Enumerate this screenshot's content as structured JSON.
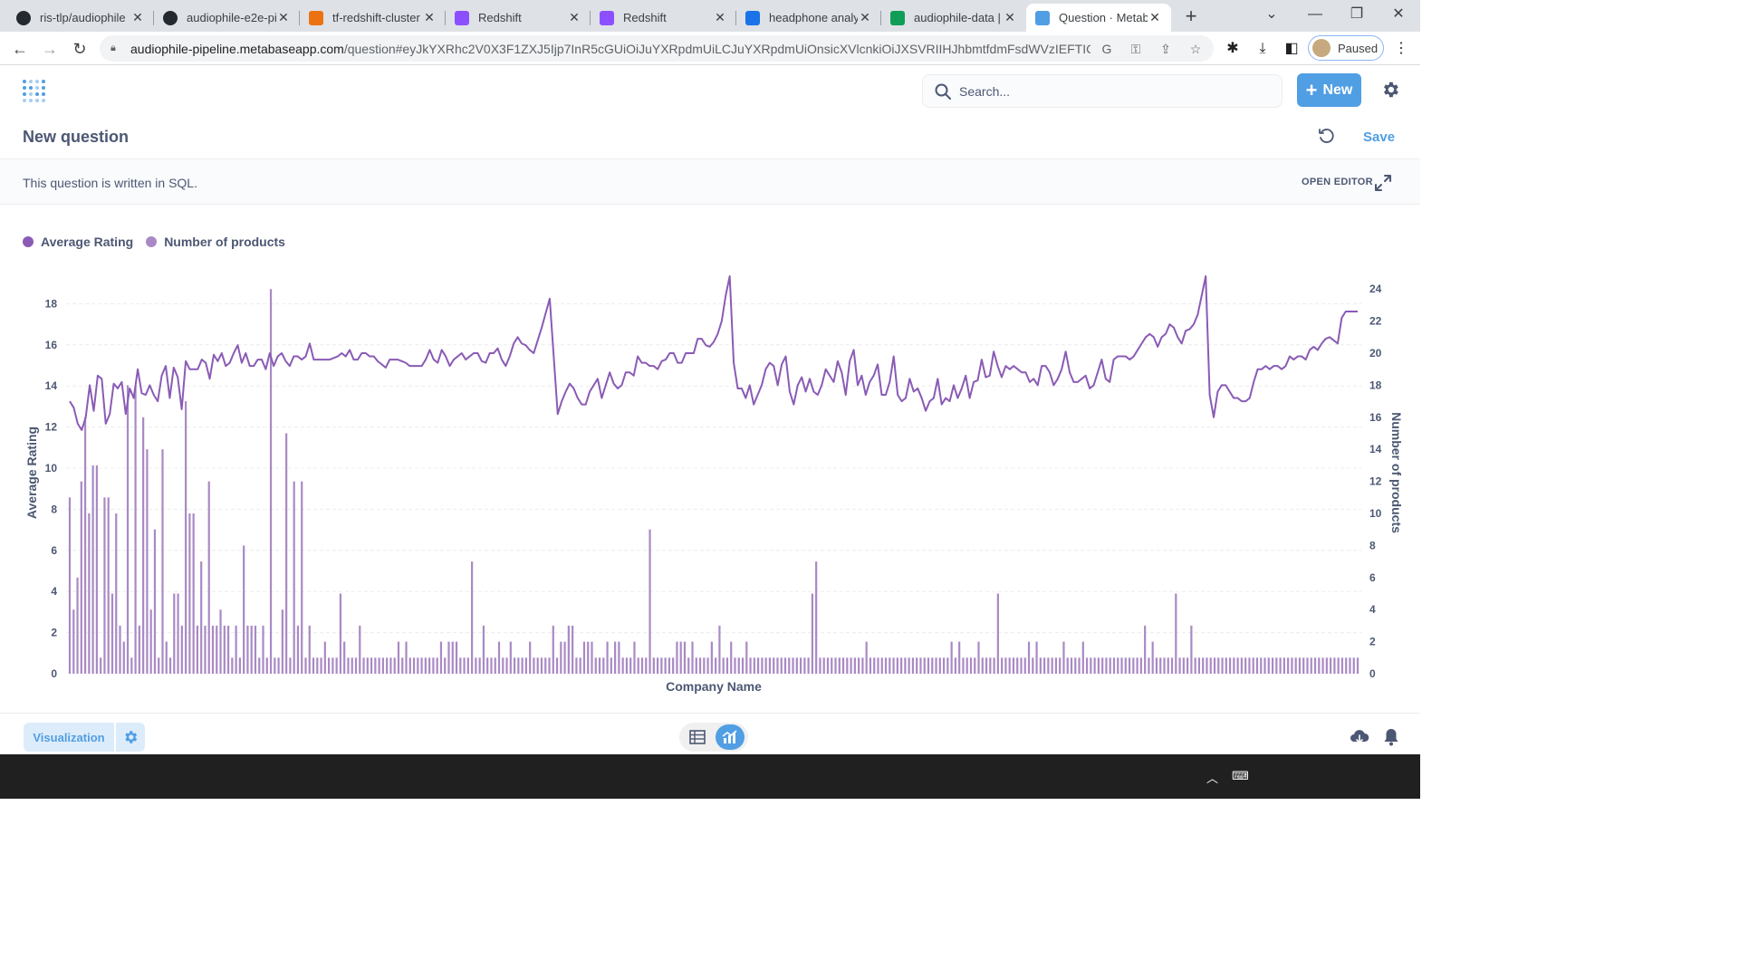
{
  "browser": {
    "tabs": [
      {
        "label": "ris-tlp/audiophile",
        "favicon": "github-icon",
        "color": "#24292f"
      },
      {
        "label": "audiophile-e2e-pi",
        "favicon": "github-icon",
        "color": "#24292f"
      },
      {
        "label": "tf-redshift-cluster",
        "favicon": "aws-icon",
        "color": "#ec7211"
      },
      {
        "label": "Redshift",
        "favicon": "redshift-icon",
        "color": "#8c4fff"
      },
      {
        "label": "Redshift",
        "favicon": "redshift-icon",
        "color": "#8c4fff"
      },
      {
        "label": "headphone analy",
        "favicon": "chart-icon",
        "color": "#1a73e8"
      },
      {
        "label": "audiophile-data |",
        "favicon": "sheets-icon",
        "color": "#0f9d58"
      },
      {
        "label": "Question · Metab",
        "favicon": "metabase-icon",
        "color": "#509ee3"
      }
    ],
    "url_host": "audiophile-pipeline.metabaseapp.com",
    "url_path": "/question#eyJkYXRhc2V0X3F1ZXJ5Ijp7InR5cGUiOiJuYXRpdmUiLCJuYXRpdmUiOnsicXVlcnkiOiJXSVRIIHJhbmtfdmFsdWVzIEFTICh...",
    "profile_label": "Paused"
  },
  "nav": {
    "search_placeholder": "Search...",
    "new_label": "New"
  },
  "question": {
    "title": "New question",
    "save_label": "Save",
    "sql_notice": "This question is written in SQL.",
    "open_editor_label": "OPEN EDITOR"
  },
  "footer": {
    "visualization_label": "Visualization"
  },
  "colors": {
    "accent": "#509ee3",
    "line_series": "#8a5bb5",
    "bar_series": "#a989c5"
  },
  "chart_data": {
    "type": "bar",
    "combo": "line + bar",
    "xlabel": "Company Name",
    "ylabel_left": "Average Rating",
    "ylabel_right": "Number of products",
    "ylim_left": [
      0,
      19.5
    ],
    "ylim_right": [
      0,
      25
    ],
    "yticks_left": [
      0,
      2,
      4,
      6,
      8,
      10,
      12,
      14,
      16,
      18
    ],
    "yticks_right": [
      0,
      2,
      4,
      6,
      8,
      10,
      12,
      14,
      16,
      18,
      20,
      22,
      24
    ],
    "legend_position": "top-left",
    "grid": true,
    "series": [
      {
        "name": "Average Rating",
        "axis": "left",
        "render": "line",
        "values": [
          17,
          16.6,
          15.6,
          15.2,
          16,
          18,
          16.4,
          18.6,
          18.4,
          15.6,
          16.2,
          18.1,
          17.8,
          18.2,
          16.2,
          17.8,
          17.2,
          19,
          17.5,
          17.4,
          18,
          17.4,
          17,
          18.6,
          19.2,
          17.2,
          19.1,
          18.5,
          16.5,
          19.5,
          19,
          19,
          19,
          19.6,
          19.4,
          18.4,
          19.9,
          19.5,
          20,
          19.2,
          19.4,
          20,
          20.5,
          19.4,
          20,
          19.2,
          19.2,
          19.6,
          19.6,
          19,
          20,
          19.2,
          19.8,
          20,
          19.5,
          19.2,
          19.8,
          19.8,
          19.6,
          19.8,
          20.6,
          19.6,
          19.6,
          19.6,
          19.6,
          19.6,
          19.7,
          19.8,
          20,
          19.8,
          20.2,
          19.6,
          19.6,
          20,
          20,
          19.8,
          19.8,
          19.5,
          19.3,
          19.1,
          19.6,
          19.6,
          19.6,
          19.5,
          19.4,
          19.2,
          19.2,
          19.2,
          19.2,
          19.6,
          20.2,
          19.6,
          19.4,
          20.2,
          19.8,
          19.2,
          19.6,
          19.8,
          20,
          19.6,
          19.8,
          20,
          20,
          19.5,
          19.4,
          20,
          20,
          20.3,
          19.6,
          19.2,
          19.8,
          20.6,
          21,
          20.6,
          20.5,
          20.2,
          20,
          20.8,
          21.6,
          22.5,
          23.4,
          19.8,
          16.2,
          17,
          17.6,
          18.1,
          17.8,
          17.2,
          16.8,
          16.8,
          17.6,
          18,
          18.4,
          17.2,
          18,
          18.8,
          18.1,
          17.8,
          18,
          18.8,
          18.8,
          18.6,
          19.8,
          19.4,
          19.4,
          19.2,
          19.2,
          19,
          19.5,
          19.6,
          20,
          20,
          19.4,
          19.4,
          20,
          20,
          20,
          20.9,
          20.9,
          20.5,
          20.4,
          20.7,
          21.2,
          22,
          23.6,
          24.8,
          19.4,
          17.8,
          17.8,
          17.2,
          18,
          16.8,
          17.4,
          18,
          19,
          19.4,
          19.2,
          18,
          19.3,
          19.8,
          17.6,
          16.8,
          18,
          18.5,
          17.6,
          18.4,
          17.6,
          17.4,
          18,
          19,
          18.6,
          18.2,
          19.5,
          18.8,
          17.4,
          19.5,
          20.2,
          18,
          18.6,
          17.4,
          18.2,
          18.6,
          19.3,
          17.4,
          17.4,
          18.2,
          19.8,
          17.4,
          17,
          17.2,
          18.4,
          17.6,
          17.8,
          17.2,
          16.4,
          17,
          17.2,
          18.4,
          16.8,
          17.2,
          17,
          18,
          17.2,
          17.8,
          18.6,
          17.2,
          18.2,
          18.3,
          19.6,
          18.5,
          18.6,
          20.1,
          19.2,
          18.5,
          19.2,
          19,
          19.2,
          19,
          18.8,
          18.8,
          18.2,
          18.4,
          18,
          19.2,
          19.2,
          18.8,
          18,
          18.4,
          19,
          20.1,
          18.8,
          18.2,
          18.2,
          18.4,
          18.6,
          17.8,
          18,
          18.8,
          19.6,
          18.4,
          18.2,
          19.6,
          19.8,
          19.8,
          19.8,
          19.6,
          19.8,
          20.2,
          20.6,
          21,
          21.2,
          21,
          20.4,
          21,
          21.2,
          21.8,
          21.6,
          21,
          20.6,
          21.4,
          21.5,
          21.8,
          22.4,
          23.6,
          24.8,
          17.4,
          16,
          17.6,
          18,
          18,
          17.6,
          17.2,
          17.2,
          17,
          17,
          17.2,
          18.2,
          19,
          19,
          19.2,
          19,
          19.2,
          19.2,
          19,
          19.2,
          19.8,
          19.6,
          19.8,
          19.8,
          19.6,
          20.2,
          20.4,
          20.2,
          20.6,
          20.9,
          21,
          20.8,
          20.6,
          22.2,
          22.6,
          22.6,
          22.6,
          22.6
        ]
      },
      {
        "name": "Number of products",
        "axis": "right",
        "render": "bar",
        "values": [
          11,
          4,
          6,
          12,
          16,
          10,
          13,
          13,
          1,
          11,
          11,
          5,
          10,
          3,
          2,
          18,
          1,
          18,
          3,
          16,
          14,
          4,
          9,
          1,
          14,
          2,
          1,
          5,
          5,
          3,
          17,
          10,
          10,
          3,
          7,
          3,
          12,
          3,
          3,
          4,
          3,
          3,
          1,
          3,
          1,
          8,
          3,
          3,
          3,
          1,
          3,
          1,
          24,
          1,
          1,
          4,
          15,
          1,
          12,
          3,
          12,
          1,
          3,
          1,
          1,
          1,
          2,
          1,
          1,
          1,
          5,
          2,
          1,
          1,
          1,
          3,
          1,
          1,
          1,
          1,
          1,
          1,
          1,
          1,
          1,
          2,
          1,
          2,
          1,
          1,
          1,
          1,
          1,
          1,
          1,
          1,
          2,
          1,
          2,
          2,
          2,
          1,
          1,
          1,
          7,
          1,
          1,
          3,
          1,
          1,
          1,
          2,
          1,
          1,
          2,
          1,
          1,
          1,
          1,
          2,
          1,
          1,
          1,
          1,
          1,
          3,
          1,
          2,
          2,
          3,
          3,
          1,
          1,
          2,
          2,
          2,
          1,
          1,
          1,
          2,
          1,
          2,
          2,
          1,
          1,
          1,
          2,
          1,
          1,
          1,
          9,
          1,
          1,
          1,
          1,
          1,
          1,
          2,
          2,
          2,
          1,
          2,
          1,
          1,
          1,
          1,
          2,
          1,
          3,
          1,
          1,
          2,
          1,
          1,
          1,
          2,
          1,
          1,
          1,
          1,
          1,
          1,
          1,
          1,
          1,
          1,
          1,
          1,
          1,
          1,
          1,
          1,
          5,
          7,
          1,
          1,
          1,
          1,
          1,
          1,
          1,
          1,
          1,
          1,
          1,
          1,
          2,
          1,
          1,
          1,
          1,
          1,
          1,
          1,
          1,
          1,
          1,
          1,
          1,
          1,
          1,
          1,
          1,
          1,
          1,
          1,
          1,
          1,
          2,
          1,
          2,
          1,
          1,
          1,
          1,
          2,
          1,
          1,
          1,
          1,
          5,
          1,
          1,
          1,
          1,
          1,
          1,
          1,
          2,
          1,
          2,
          1,
          1,
          1,
          1,
          1,
          1,
          2,
          1,
          1,
          1,
          1,
          2,
          1,
          1,
          1,
          1,
          1,
          1,
          1,
          1,
          1,
          1,
          1,
          1,
          1,
          1,
          1,
          3,
          1,
          2,
          1,
          1,
          1,
          1,
          1,
          5,
          1,
          1,
          1,
          3,
          1,
          1,
          1,
          1,
          1,
          1,
          1,
          1,
          1,
          1,
          1,
          1,
          1,
          1,
          1,
          1,
          1,
          1,
          1,
          1,
          1,
          1,
          1,
          1,
          1,
          1,
          1,
          1,
          1,
          1,
          1,
          1,
          1,
          1,
          1,
          1,
          1,
          1,
          1,
          1,
          1,
          1,
          1
        ]
      }
    ]
  }
}
